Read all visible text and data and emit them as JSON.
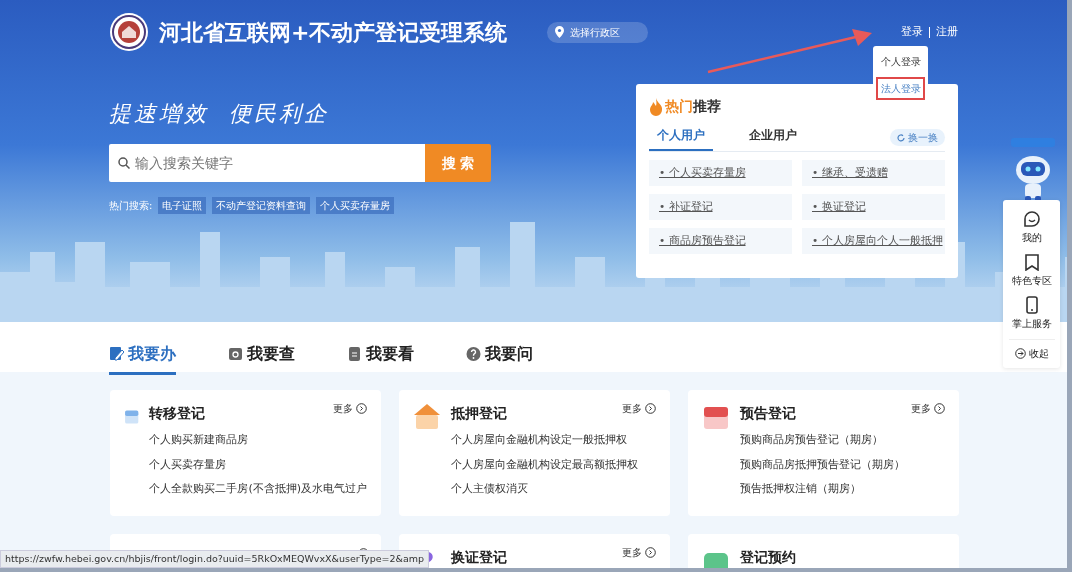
{
  "header": {
    "title": "河北省互联网+不动产登记受理系统",
    "region": "选择行政区",
    "login": "登录",
    "register": "注册",
    "login_menu": [
      {
        "label": "个人登录",
        "highlighted": false
      },
      {
        "label": "法人登录",
        "highlighted": true
      }
    ],
    "slogan": "提速增效  便民利企"
  },
  "search": {
    "placeholder": "输入搜索关键字",
    "button": "搜 索",
    "hot_label": "热门搜索:",
    "hot_terms": [
      "电子证照",
      "不动产登记资料查询",
      "个人买卖存量房"
    ]
  },
  "hot_panel": {
    "title_hot": "热门",
    "title_rest": "推荐",
    "tabs": [
      {
        "label": "个人用户",
        "selected": true
      },
      {
        "label": "企业用户",
        "selected": false
      }
    ],
    "refresh": "换一换",
    "items": [
      "•  个人买卖存量房",
      "•  继承、受遗赠",
      "•  补证登记",
      "•  换证登记",
      "•  商品房预告登记",
      "•  个人房屋向个人一般抵押"
    ]
  },
  "side_panel": {
    "items": [
      {
        "label": "我的"
      },
      {
        "label": "特色专区"
      },
      {
        "label": "掌上服务"
      }
    ],
    "collapse": "收起"
  },
  "section_tabs": [
    {
      "label": "我要办",
      "selected": true
    },
    {
      "label": "我要查",
      "selected": false
    },
    {
      "label": "我要看",
      "selected": false
    },
    {
      "label": "我要问",
      "selected": false
    }
  ],
  "cards": [
    {
      "kind": "full",
      "title": "转移登记",
      "more": "更多",
      "items": [
        "个人购买新建商品房",
        "个人买卖存量房",
        "个人全款购买二手房(不含抵押)及水电气过户"
      ]
    },
    {
      "kind": "full",
      "title": "抵押登记",
      "more": "更多",
      "items": [
        "个人房屋向金融机构设定一般抵押权",
        "个人房屋向金融机构设定最高额抵押权",
        "个人主债权消灭"
      ]
    },
    {
      "kind": "full",
      "title": "预告登记",
      "more": "更多",
      "items": [
        "预购商品房预告登记（期房）",
        "预购商品房抵押预告登记（期房）",
        "预告抵押权注销（期房）"
      ]
    },
    {
      "kind": "covered"
    },
    {
      "kind": "full",
      "title": "换证登记",
      "more": "更多"
    },
    {
      "kind": "full",
      "title": "登记预约"
    }
  ],
  "status_bar": {
    "url": "https://zwfw.hebei.gov.cn/hbjis/front/login.do?uuid=5RkOxMEQWvxX&userType=2&amp"
  }
}
